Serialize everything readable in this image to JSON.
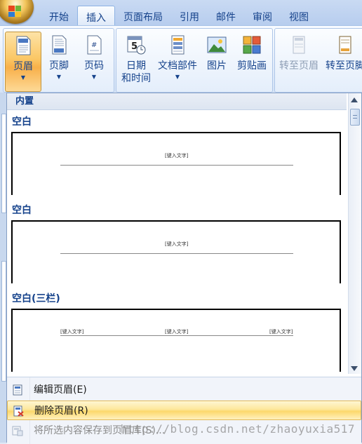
{
  "ribbon_tabs": [
    "开始",
    "插入",
    "页面布局",
    "引用",
    "邮件",
    "审阅",
    "视图"
  ],
  "active_tab": "插入",
  "ribbon_buttons": {
    "header": "页眉",
    "footer": "页脚",
    "page_number": "页码",
    "date_time_line1": "日期",
    "date_time_line2": "和时间",
    "quick_parts": "文档部件",
    "picture": "图片",
    "clip_art": "剪贴画",
    "goto_header": "转至页眉",
    "goto_footer": "转至页脚"
  },
  "dropdown": {
    "section_header": "内置",
    "items": [
      {
        "label": "空白",
        "placeholder": "[键入文字]"
      },
      {
        "label": "空白",
        "placeholder": "[键入文字]"
      },
      {
        "label": "空白(三栏)",
        "placeholders": [
          "[键入文字]",
          "[键入文字]",
          "[键入文字]"
        ]
      }
    ]
  },
  "menu": {
    "edit_header": "编辑页眉(E)",
    "remove_header": "删除页眉(R)",
    "save_selection": "将所选内容保存到页眉库(S)..."
  },
  "watermark": "http://blog.csdn.net/zhaoyuxia517"
}
